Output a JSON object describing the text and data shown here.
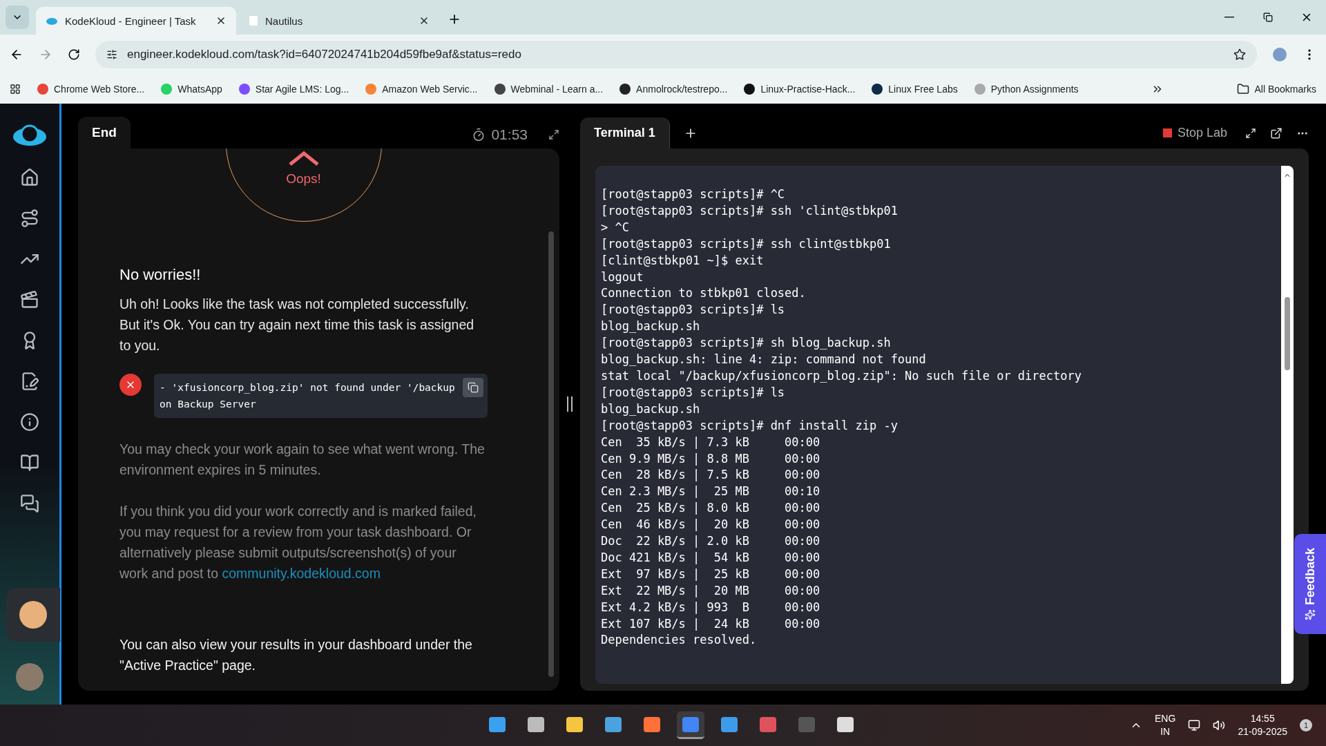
{
  "browser": {
    "tabs": [
      {
        "title": "KodeKloud - Engineer | Task",
        "selected": true,
        "kind": "kodekloud"
      },
      {
        "title": "Nautilus",
        "selected": false,
        "kind": "blank"
      }
    ],
    "url": "engineer.kodekloud.com/task?id=64072024741b204d59fbe9af&status=redo",
    "bookmarks": [
      {
        "label": "Chrome Web Store...",
        "color": "#e8453c"
      },
      {
        "label": "WhatsApp",
        "color": "#25d366"
      },
      {
        "label": "Star Agile LMS: Log...",
        "color": "#7c4dff"
      },
      {
        "label": "Amazon Web Servic...",
        "color": "#f58536"
      },
      {
        "label": "Webminal - Learn a...",
        "color": "#444444"
      },
      {
        "label": "Anmolrock/testrepo...",
        "color": "#222222"
      },
      {
        "label": "Linux-Practise-Hack...",
        "color": "#111111"
      },
      {
        "label": "Linux Free Labs",
        "color": "#0d2a4a"
      },
      {
        "label": "Python Assignments",
        "color": "#aaaaaa"
      }
    ],
    "all_bookmarks": "All Bookmarks"
  },
  "task": {
    "tab": "End",
    "timer": "01:53",
    "status": "Oops!",
    "heading": "No worries!!",
    "message": "Uh oh! Looks like the task was not completed successfully. But it's Ok. You can try again next time this task is assigned to you.",
    "error_lines": [
      "- 'xfusioncorp_blog.zip' not found under '/backup",
      "on Backup Server"
    ],
    "check_again": "You may check your work again to see what went wrong. The environment expires in 5 minutes.",
    "review": "If you think you did your work correctly and is marked failed, you may request for a review from your task dashboard. Or alternatively please submit outputs/screenshot(s) of your work and post to",
    "review_link": "community.kodekloud.com",
    "results": "You can also view your results in your dashboard under the \"Active Practice\" page."
  },
  "terminal": {
    "tab": "Terminal 1",
    "stop": "Stop Lab",
    "lines": [
      "[root@stapp03 scripts]# ^C",
      "[root@stapp03 scripts]# ssh 'clint@stbkp01",
      "> ^C",
      "[root@stapp03 scripts]# ssh clint@stbkp01",
      "[clint@stbkp01 ~]$ exit",
      "logout",
      "Connection to stbkp01 closed.",
      "[root@stapp03 scripts]# ls",
      "blog_backup.sh",
      "[root@stapp03 scripts]# sh blog_backup.sh",
      "blog_backup.sh: line 4: zip: command not found",
      "stat local \"/backup/xfusioncorp_blog.zip\": No such file or directory",
      "[root@stapp03 scripts]# ls",
      "blog_backup.sh",
      "[root@stapp03 scripts]# dnf install zip -y",
      "Cen  35 kB/s | 7.3 kB     00:00",
      "Cen 9.9 MB/s | 8.8 MB     00:00",
      "Cen  28 kB/s | 7.5 kB     00:00",
      "Cen 2.3 MB/s |  25 MB     00:10",
      "Cen  25 kB/s | 8.0 kB     00:00",
      "Cen  46 kB/s |  20 kB     00:00",
      "Doc  22 kB/s | 2.0 kB     00:00",
      "Doc 421 kB/s |  54 kB     00:00",
      "Ext  97 kB/s |  25 kB     00:00",
      "Ext  22 MB/s |  20 MB     00:00",
      "Ext 4.2 kB/s | 993  B     00:00",
      "Ext 107 kB/s |  24 kB     00:00",
      "Dependencies resolved."
    ]
  },
  "feedback": "Feedback",
  "taskbar": {
    "apps": [
      {
        "kind": "windows",
        "selected": false
      },
      {
        "kind": "taskview",
        "selected": false
      },
      {
        "kind": "folder",
        "selected": false
      },
      {
        "kind": "chart",
        "selected": false
      },
      {
        "kind": "firefox",
        "selected": false
      },
      {
        "kind": "chrome",
        "selected": true
      },
      {
        "kind": "notepad",
        "selected": false
      },
      {
        "kind": "snip",
        "selected": false
      },
      {
        "kind": "terminal",
        "selected": false
      },
      {
        "kind": "player",
        "selected": false
      }
    ],
    "language": "ENG",
    "region": "IN",
    "time": "14:55",
    "date": "21-09-2025",
    "notifications": "1"
  }
}
